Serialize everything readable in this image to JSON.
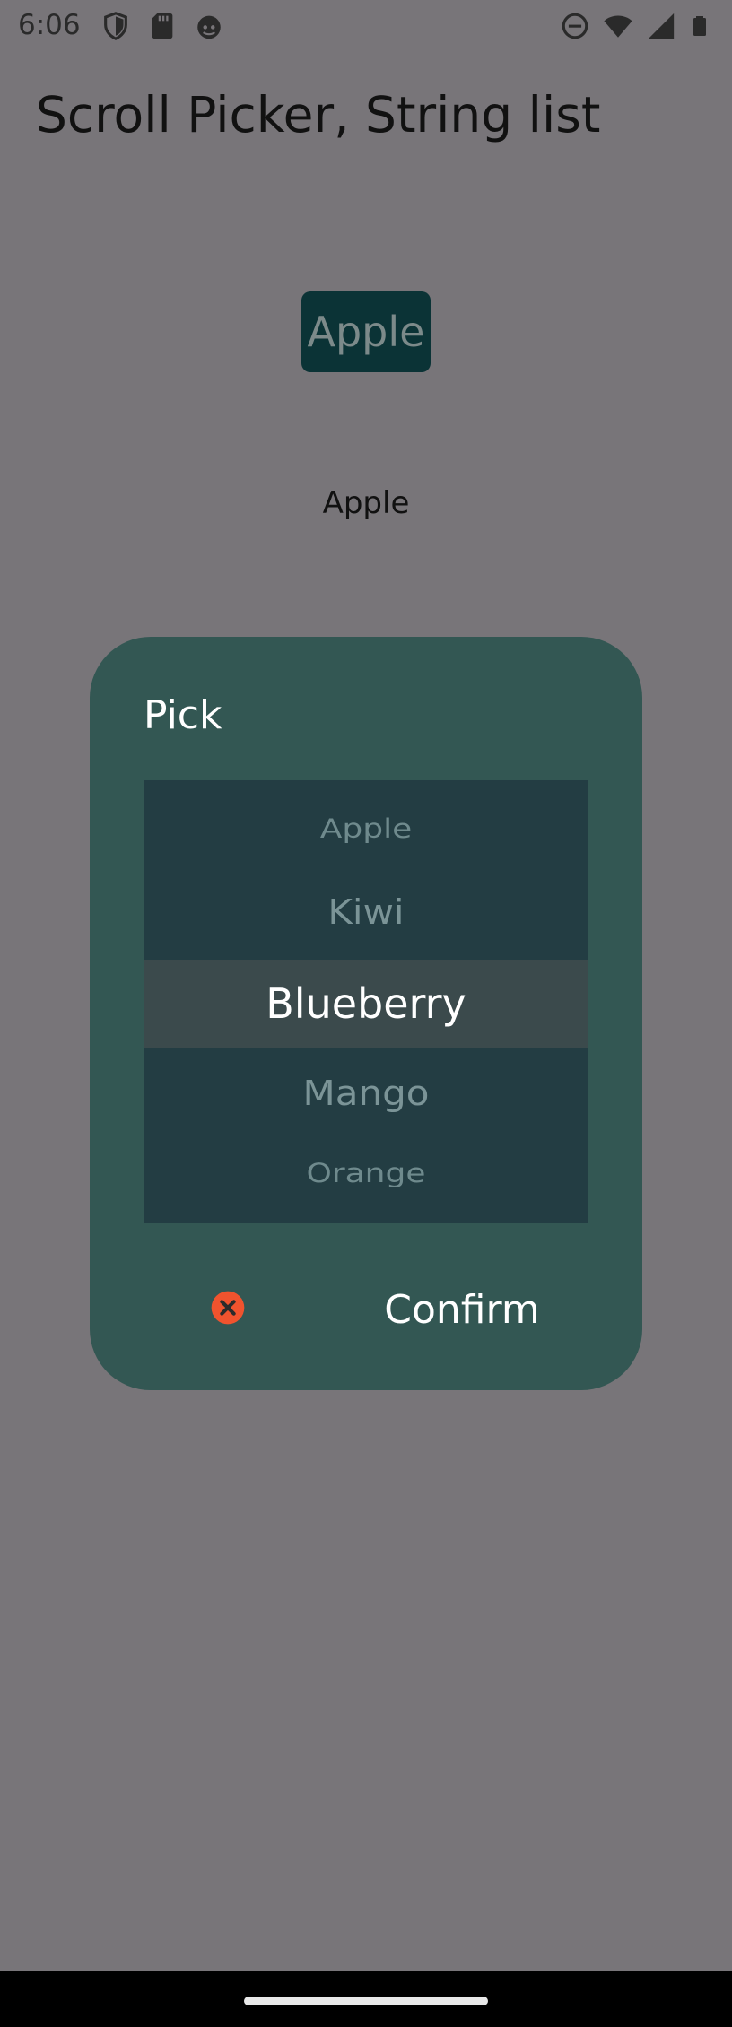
{
  "status_bar": {
    "time": "6:06",
    "left_icons": [
      "shield-icon",
      "sd-card-icon",
      "android-face-icon"
    ],
    "right_icons": [
      "do-not-disturb-icon",
      "wifi-icon",
      "signal-icon",
      "battery-icon"
    ]
  },
  "app": {
    "title": "Scroll Picker, String list",
    "button_label": "Apple",
    "selected_value": "Apple"
  },
  "dialog": {
    "title": "Pick",
    "picker_items": [
      "Apple",
      "Kiwi",
      "Blueberry",
      "Mango",
      "Orange"
    ],
    "selected_item": "Blueberry",
    "cancel_icon": "close-circle-icon",
    "confirm_label": "Confirm"
  },
  "colors": {
    "scrim_background": "#787579",
    "dialog_background": "#335753",
    "picker_background": "#233d43",
    "cancel_icon_color": "#f0532e"
  }
}
